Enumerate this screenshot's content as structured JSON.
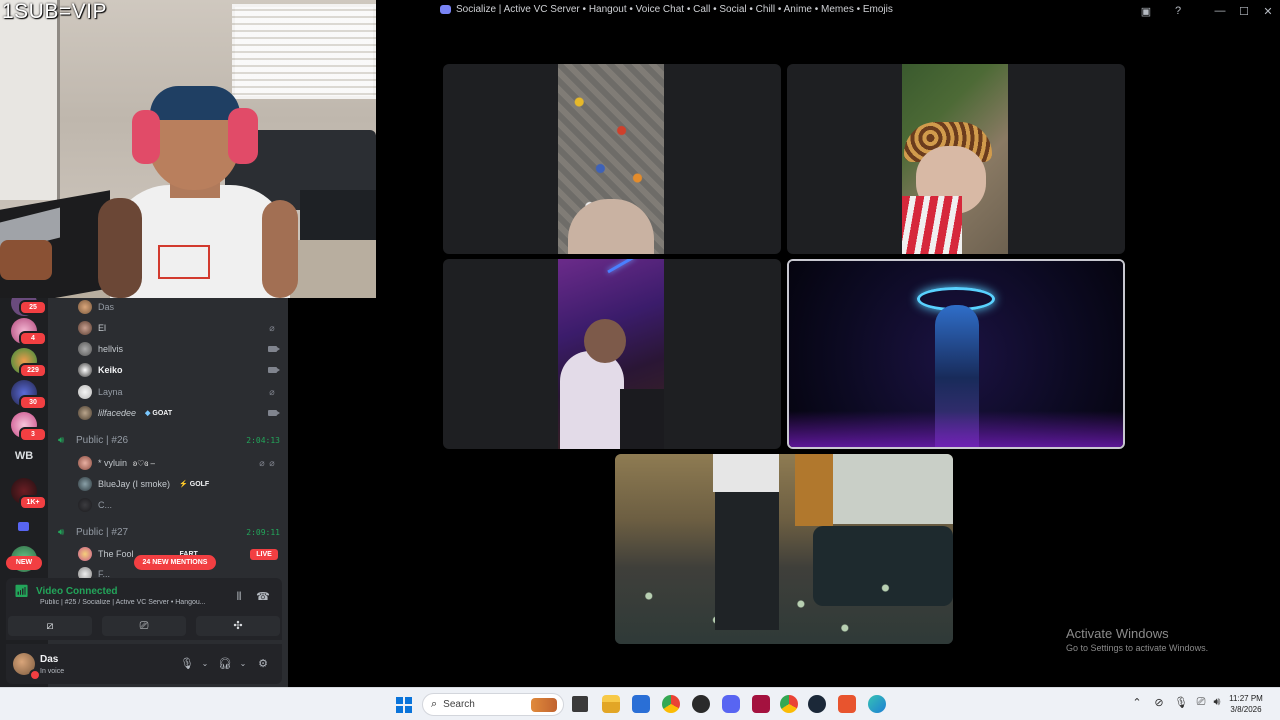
{
  "window": {
    "title": "Socialize | Active VC Server • Hangout • Voice Chat • Call • Social • Chill • Anime • Memes • Emojis"
  },
  "stream_overlay": {
    "text": "1SUB=VIP"
  },
  "servers": {
    "badges": [
      "25",
      "4",
      "229",
      "30",
      "3",
      "1K+"
    ],
    "wb_label": "WB",
    "new_label": "NEW"
  },
  "voice_members_top": [
    {
      "name": "Das",
      "style": "dim"
    },
    {
      "name": "El",
      "style": "mid"
    },
    {
      "name": "hellvis",
      "style": "mid"
    },
    {
      "name": "Keiko",
      "style": "bright"
    },
    {
      "name": "Layna",
      "style": "dim"
    },
    {
      "name": "lilfacedee",
      "style": "mid",
      "tag": "GOAT"
    }
  ],
  "channels": [
    {
      "name": "Public | #26",
      "duration": "2:04:13"
    },
    {
      "name": "Public | #27",
      "duration": "2:09:11"
    }
  ],
  "channel_26_members": [
    {
      "name": "* vyluin",
      "suffix": "ʚ♡ɞ ‒"
    },
    {
      "name": "BlueJay (I smoke)",
      "tag": "GOLF"
    },
    {
      "name": "C..."
    }
  ],
  "channel_27_members": [
    {
      "name": "The Fool",
      "tag": "FART",
      "live": "LIVE"
    },
    {
      "name": "F..."
    }
  ],
  "mentions_label": "24 NEW MENTIONS",
  "voice_panel": {
    "status": "Video Connected",
    "location": "Public | #25 / Socialize | Active VC Server • Hangou..."
  },
  "user": {
    "name": "Das",
    "status": "In voice"
  },
  "activate_windows": {
    "heading": "Activate Windows",
    "sub": "Go to Settings to activate Windows."
  },
  "taskbar": {
    "search_placeholder": "Search",
    "time": "11:27 PM",
    "date": "3/8/2026"
  },
  "colors": {
    "discord_bg": "#2b2d31",
    "guild_bar": "#1e1f22",
    "green": "#23a55a",
    "red_badge": "#f23f42",
    "blurple": "#5865f2"
  }
}
